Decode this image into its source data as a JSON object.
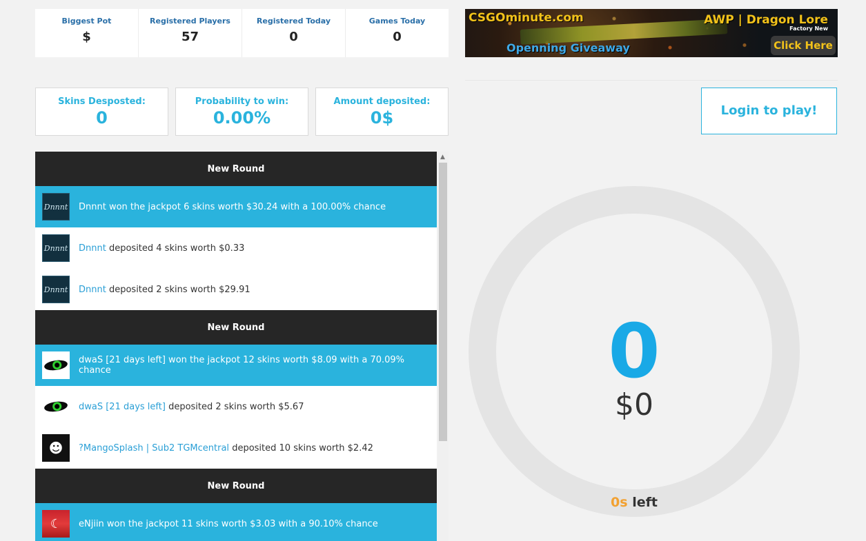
{
  "top_stats": [
    {
      "label": "Biggest Pot",
      "value": "$"
    },
    {
      "label": "Registered Players",
      "value": "57"
    },
    {
      "label": "Registered Today",
      "value": "0"
    },
    {
      "label": "Games Today",
      "value": "0"
    }
  ],
  "banner": {
    "site": "CSGOminute.com",
    "title": "AWP | Dragon Lore",
    "subtitle": "Factory New",
    "giveaway": "Openning Giveaway",
    "button": "Click Here"
  },
  "player_stats": [
    {
      "label": "Skins Desposted:",
      "value": "0"
    },
    {
      "label": "Probability to win:",
      "value": "0.00%"
    },
    {
      "label": "Amount deposited:",
      "value": "0$"
    }
  ],
  "login_label": "Login to play!",
  "feed": {
    "round_label": "New Round",
    "rows": [
      {
        "type": "round"
      },
      {
        "type": "win",
        "avatar": "Dnnnt",
        "text": "Dnnnt won the jackpot 6 skins worth $30.24 with a 100.00% chance"
      },
      {
        "type": "dep",
        "avatar": "Dnnnt",
        "name": "Dnnnt",
        "text": " deposited 4 skins worth $0.33"
      },
      {
        "type": "dep",
        "avatar": "Dnnnt",
        "name": "Dnnnt",
        "text": " deposited 2 skins worth $29.91"
      },
      {
        "type": "round"
      },
      {
        "type": "win",
        "avatar": "eye",
        "text": "dwaS [21 days left] won the jackpot 12 skins worth $8.09 with a 70.09% chance"
      },
      {
        "type": "dep",
        "avatar": "eye",
        "name": "dwaS [21 days left]",
        "text": " deposited 2 skins worth $5.67"
      },
      {
        "type": "dep",
        "avatar": "mango",
        "name": "?MangoSplash | Sub2 TGMcentral",
        "text": " deposited 10 skins worth $2.42"
      },
      {
        "type": "round"
      },
      {
        "type": "win",
        "avatar": "flag",
        "text": "eNjiin won the jackpot 11 skins worth $3.03 with a 90.10% chance"
      }
    ]
  },
  "pot": {
    "skins_count": "0",
    "value": "$0",
    "time_seconds": "0s",
    "time_suffix": " left"
  }
}
